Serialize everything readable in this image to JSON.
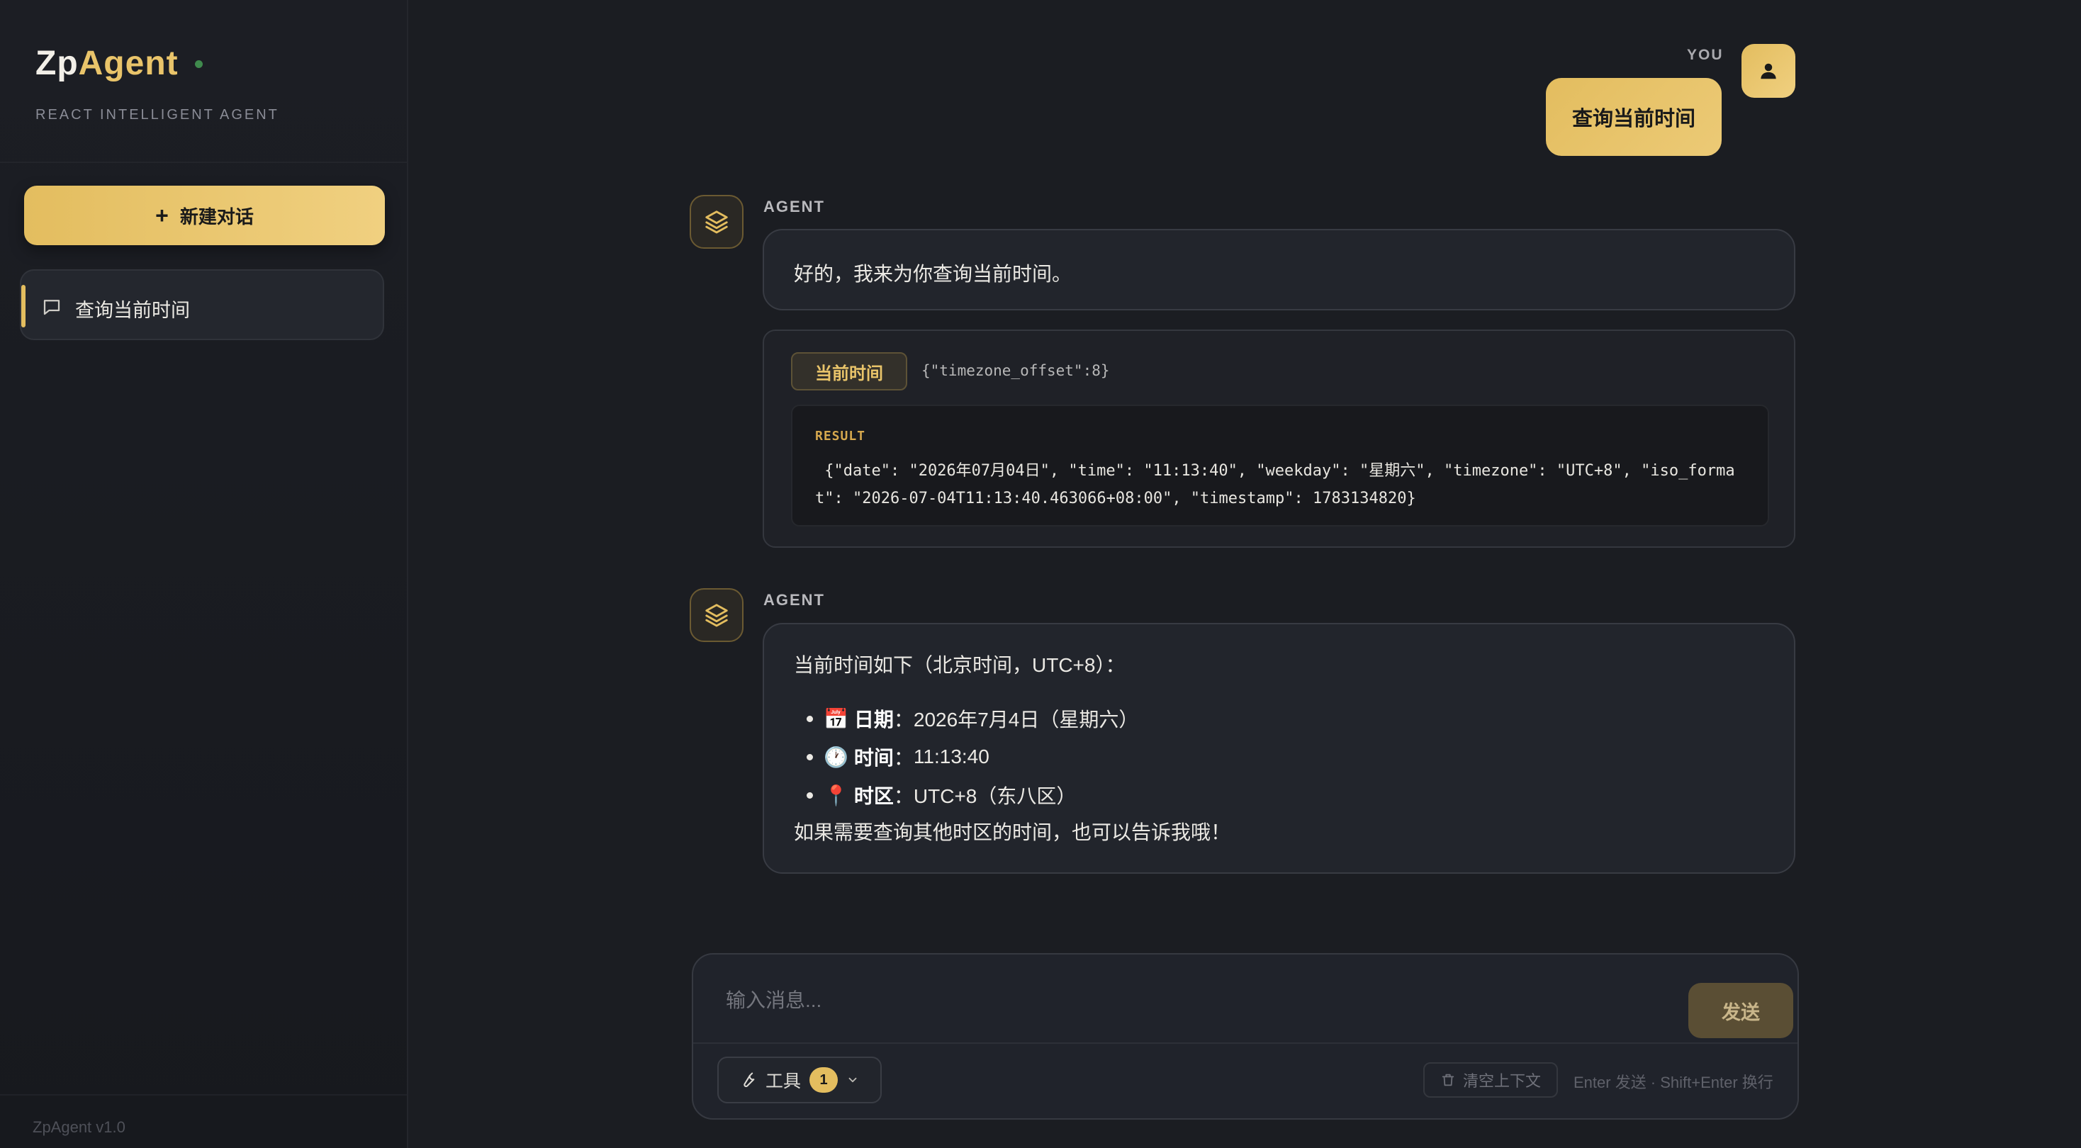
{
  "app": {
    "brand_prefix": "Zp",
    "brand_suffix": "Agent",
    "subtitle": "REACT INTELLIGENT AGENT",
    "version": "ZpAgent v1.0",
    "accent_color": "#e3bd5f"
  },
  "sidebar": {
    "new_chat_label": "新建对话",
    "conversations": [
      {
        "label": "查询当前时间",
        "active": true
      }
    ]
  },
  "messages": {
    "user": {
      "role_label": "YOU",
      "text": "查询当前时间"
    },
    "agent1": {
      "role_label": "AGENT",
      "text": "好的，我来为你查询当前时间。",
      "tool_call": {
        "name": "当前时间",
        "args": "{\"timezone_offset\":8}",
        "result_label": "RESULT",
        "result": " {\"date\": \"2026年07月04日\", \"time\": \"11:13:40\", \"weekday\": \"星期六\", \"timezone\": \"UTC+8\", \"iso_format\": \"2026-07-04T11:13:40.463066+08:00\", \"timestamp\": 1783134820}"
      }
    },
    "agent2": {
      "role_label": "AGENT",
      "intro": "当前时间如下（北京时间，UTC+8）：",
      "items": [
        {
          "emoji": "📅",
          "key": "日期",
          "sep": "：",
          "value": "2026年7月4日（星期六）"
        },
        {
          "emoji": "🕐",
          "key": "时间",
          "sep": "：",
          "value": "11:13:40"
        },
        {
          "emoji": "📍",
          "key": "时区",
          "sep": "：",
          "value": "UTC+8（东八区）"
        }
      ],
      "outro": "如果需要查询其他时区的时间，也可以告诉我哦！"
    }
  },
  "composer": {
    "placeholder": "输入消息...",
    "send_label": "发送",
    "tools_label": "工具",
    "tools_count": "1",
    "clear_label": "清空上下文",
    "hint": "Enter 发送 · Shift+Enter 换行"
  }
}
